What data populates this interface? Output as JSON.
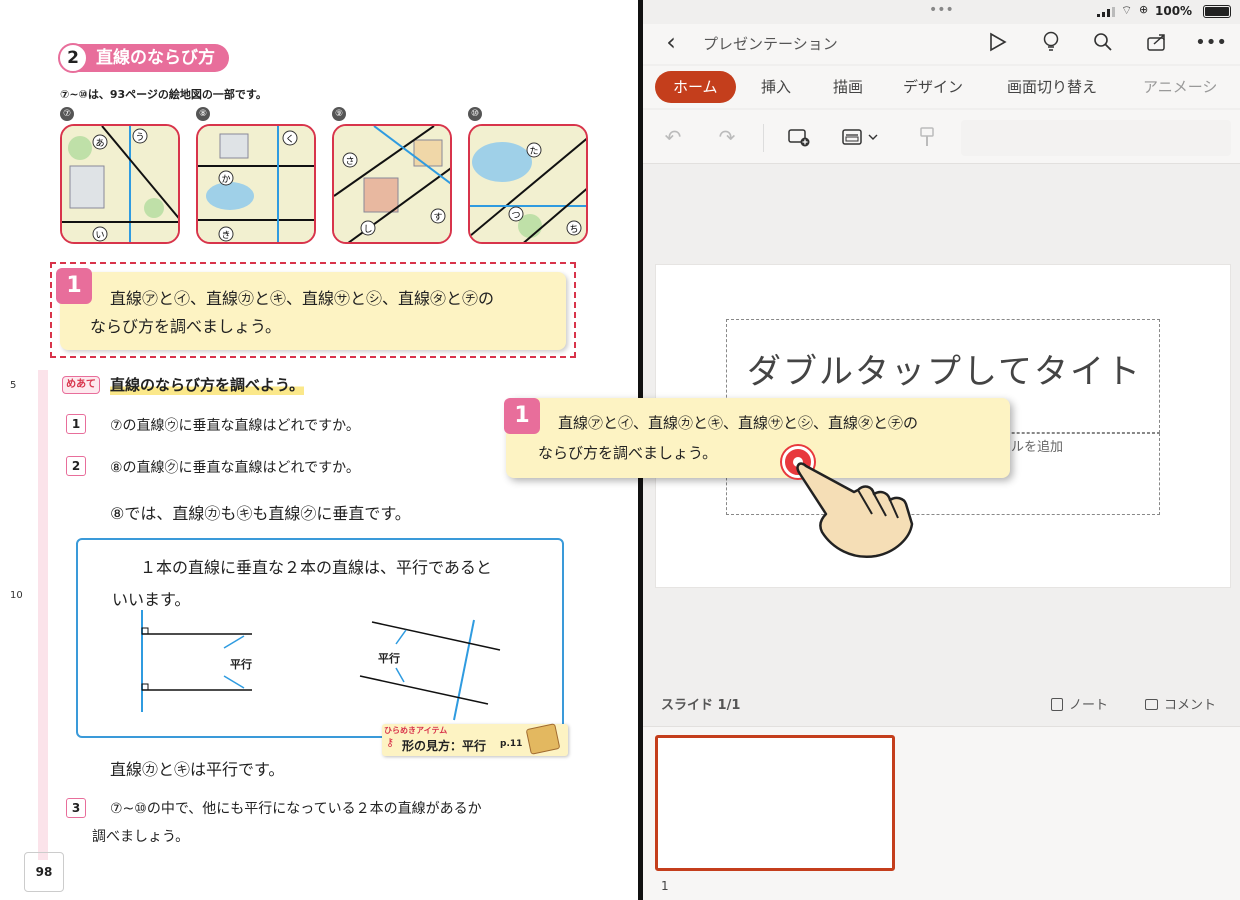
{
  "textbook": {
    "section_number": "2",
    "section_title": "直線のならび方",
    "map_note": "⑦~⑩は、93ページの絵地図の一部です。",
    "maps": [
      {
        "id": "⑦",
        "labels": [
          "あ",
          "う",
          "い"
        ]
      },
      {
        "id": "⑧",
        "labels": [
          "く",
          "か",
          "き"
        ]
      },
      {
        "id": "⑨",
        "labels": [
          "さ",
          "す",
          "し"
        ]
      },
      {
        "id": "⑩",
        "labels": [
          "た",
          "つ",
          "ち"
        ]
      }
    ],
    "task_badge": "1",
    "task_line1": "直線ⓐとⓘ、直線ⓚとⓚ、直線ⓢとⓢ、直線ⓣとⓣの",
    "task_line1_display": "直線㋐と㋑、直線㋕と㋖、直線㋚と㋛、直線㋟と㋠の",
    "task_line2": "ならび方を調べましょう。",
    "margin_5": "5",
    "margin_10": "10",
    "meate_label": "めあて",
    "meate_text": "直線のならび方を調べよう。",
    "q1_num": "1",
    "q1_text": "⑦の直線㋒に垂直な直線はどれですか。",
    "q2_num": "2",
    "q2_text": "⑧の直線㋗に垂直な直線はどれですか。",
    "q2_answer": "⑧では、直線㋕も㋖も直線㋗に垂直です。",
    "def_line1": "１本の直線に垂直な２本の直線は、平行であると",
    "def_line2": "いいます。",
    "diagram_label": "平行",
    "hirameki_small": "ひらめきアイテム",
    "hirameki_text": "形の見方：平行",
    "hirameki_page": "p.11",
    "parallel_statement": "直線㋕と㋖は平行です。",
    "q3_num": "3",
    "q3_line1": "⑦~⑩の中で、他にも平行になっている２本の直線があるか",
    "q3_line2": "調べましょう。",
    "page_number": "98"
  },
  "statusbar": {
    "dots": "•••",
    "battery": "100%"
  },
  "app": {
    "doc_title": "プレゼンテーション",
    "tabs": [
      "ホーム",
      "挿入",
      "描画",
      "デザイン",
      "画面切り替え",
      "アニメーシ"
    ],
    "active_tab": "ホーム",
    "slide_title_placeholder": "ダブルタップしてタイトルを追加",
    "slide_title_visible": "ダブルタップしてタイト",
    "slide_title_second": "ルを追加",
    "slide_subtitle_placeholder": "ルを追加",
    "slide_counter": "スライド 1/1",
    "notes_label": "ノート",
    "comments_label": "コメント",
    "thumb_number": "1"
  },
  "overlay": {
    "badge": "1",
    "line1": "直線㋐と㋑、直線㋕と㋖、直線㋚と㋛、直線㋟と㋠の",
    "line2": "ならび方を調べましょう。"
  },
  "colors": {
    "accent_pink": "#e86e9b",
    "office_red": "#c43e1c",
    "def_blue": "#3a9ad9",
    "task_yellow": "#fdf3c3"
  }
}
